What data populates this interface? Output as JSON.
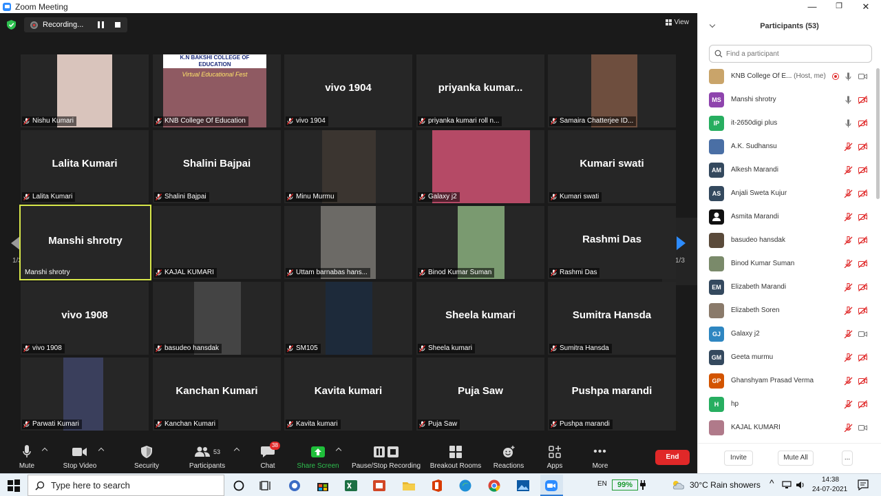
{
  "window": {
    "title": "Zoom Meeting",
    "minimize": "—",
    "maximize": "❐",
    "close": "✕"
  },
  "recording": {
    "label": "Recording..."
  },
  "view": {
    "label": "View"
  },
  "pager": {
    "left": "1/3",
    "right": "1/3"
  },
  "tiles": [
    {
      "label": "Nishu Kumari",
      "video": true,
      "name": ""
    },
    {
      "label": "KNB College Of Education",
      "video": true,
      "name": "",
      "banner": "K.N BAKSHI COLLEGE OF EDUCATION",
      "banner2": "Virtual Educational Fest"
    },
    {
      "label": "vivo 1904",
      "video": false,
      "name": "vivo 1904"
    },
    {
      "label": "priyanka kumari roll n...",
      "video": false,
      "name": "priyanka kumar..."
    },
    {
      "label": "Samaira Chatterjee ID...",
      "video": true,
      "name": ""
    },
    {
      "label": "Lalita Kumari",
      "video": false,
      "name": "Lalita Kumari"
    },
    {
      "label": "Shalini Bajpai",
      "video": false,
      "name": "Shalini Bajpai"
    },
    {
      "label": "Minu Murmu",
      "video": true,
      "name": ""
    },
    {
      "label": "Galaxy j2",
      "video": true,
      "name": ""
    },
    {
      "label": "Kumari swati",
      "video": false,
      "name": "Kumari swati"
    },
    {
      "label": "Manshi shrotry",
      "video": false,
      "name": "Manshi shrotry",
      "active": true
    },
    {
      "label": "KAJAL KUMARI",
      "video": false,
      "name": ""
    },
    {
      "label": "Uttam barnabas hans...",
      "video": true,
      "name": ""
    },
    {
      "label": "Binod Kumar Suman",
      "video": true,
      "name": ""
    },
    {
      "label": "Rashmi Das",
      "video": false,
      "name": "Rashmi Das"
    },
    {
      "label": "vivo 1908",
      "video": false,
      "name": "vivo 1908"
    },
    {
      "label": "basudeo hansdak",
      "video": true,
      "name": ""
    },
    {
      "label": "SM105",
      "video": true,
      "name": ""
    },
    {
      "label": "Sheela kumari",
      "video": false,
      "name": "Sheela kumari"
    },
    {
      "label": "Sumitra Hansda",
      "video": false,
      "name": "Sumitra Hansda"
    },
    {
      "label": "Parwati Kumari",
      "video": true,
      "name": ""
    },
    {
      "label": "Kanchan Kumari",
      "video": false,
      "name": "Kanchan Kumari"
    },
    {
      "label": "Kavita kumari",
      "video": false,
      "name": "Kavita kumari"
    },
    {
      "label": "Puja Saw",
      "video": false,
      "name": "Puja Saw"
    },
    {
      "label": "Pushpa marandi",
      "video": false,
      "name": "Pushpa marandi"
    }
  ],
  "toolbar": {
    "mute": "Mute",
    "stop_video": "Stop Video",
    "security": "Security",
    "participants": "Participants",
    "participants_count": "53",
    "chat": "Chat",
    "chat_badge": "38",
    "share": "Share Screen",
    "recording": "Pause/Stop Recording",
    "breakout": "Breakout Rooms",
    "reactions": "Reactions",
    "apps": "Apps",
    "more": "More",
    "end": "End"
  },
  "panel": {
    "title": "Participants (53)",
    "search_placeholder": "Find a participant",
    "participants": [
      {
        "name": "KNB College Of E...",
        "role": "(Host, me)",
        "initials": "",
        "color": "#c9a46a",
        "mic": "on",
        "video": "on"
      },
      {
        "name": "Manshi shrotry",
        "initials": "MS",
        "color": "#8e44ad",
        "mic": "on",
        "video": "off"
      },
      {
        "name": "it-2650digi plus",
        "initials": "IP",
        "color": "#27ae60",
        "mic": "on",
        "video": "off"
      },
      {
        "name": "A.K. Sudhansu",
        "initials": "",
        "color": "#4a6fa5",
        "mic": "off",
        "video": "off"
      },
      {
        "name": "Alkesh Marandi",
        "initials": "AM",
        "color": "#34495e",
        "mic": "off",
        "video": "off"
      },
      {
        "name": "Anjali Sweta Kujur",
        "initials": "AS",
        "color": "#34495e",
        "mic": "off",
        "video": "off"
      },
      {
        "name": "Asmita Marandi",
        "initials": "",
        "color": "#111111",
        "mic": "off",
        "video": "off"
      },
      {
        "name": "basudeo hansdak",
        "initials": "",
        "color": "#5a4a3a",
        "mic": "off",
        "video": "off"
      },
      {
        "name": "Binod Kumar Suman",
        "initials": "",
        "color": "#7a8a6a",
        "mic": "off",
        "video": "off"
      },
      {
        "name": "Elizabeth Marandi",
        "initials": "EM",
        "color": "#34495e",
        "mic": "off",
        "video": "off"
      },
      {
        "name": "Elizabeth Soren",
        "initials": "",
        "color": "#8a7a6a",
        "mic": "off",
        "video": "off"
      },
      {
        "name": "Galaxy j2",
        "initials": "GJ",
        "color": "#2e86c1",
        "mic": "off",
        "video": "on"
      },
      {
        "name": "Geeta murmu",
        "initials": "GM",
        "color": "#34495e",
        "mic": "off",
        "video": "off"
      },
      {
        "name": "Ghanshyam Prasad Verma",
        "initials": "GP",
        "color": "#d35400",
        "mic": "off",
        "video": "off"
      },
      {
        "name": "hp",
        "initials": "H",
        "color": "#27ae60",
        "mic": "off",
        "video": "off"
      },
      {
        "name": "KAJAL KUMARI",
        "initials": "",
        "color": "#b07a8a",
        "mic": "off",
        "video": "on"
      }
    ],
    "invite": "Invite",
    "mute_all": "Mute All",
    "more": "..."
  },
  "taskbar": {
    "search_placeholder": "Type here to search",
    "lang": "EN",
    "battery": "99%",
    "weather": "30°C  Rain showers",
    "time": "14:38",
    "date": "24-07-2021"
  }
}
